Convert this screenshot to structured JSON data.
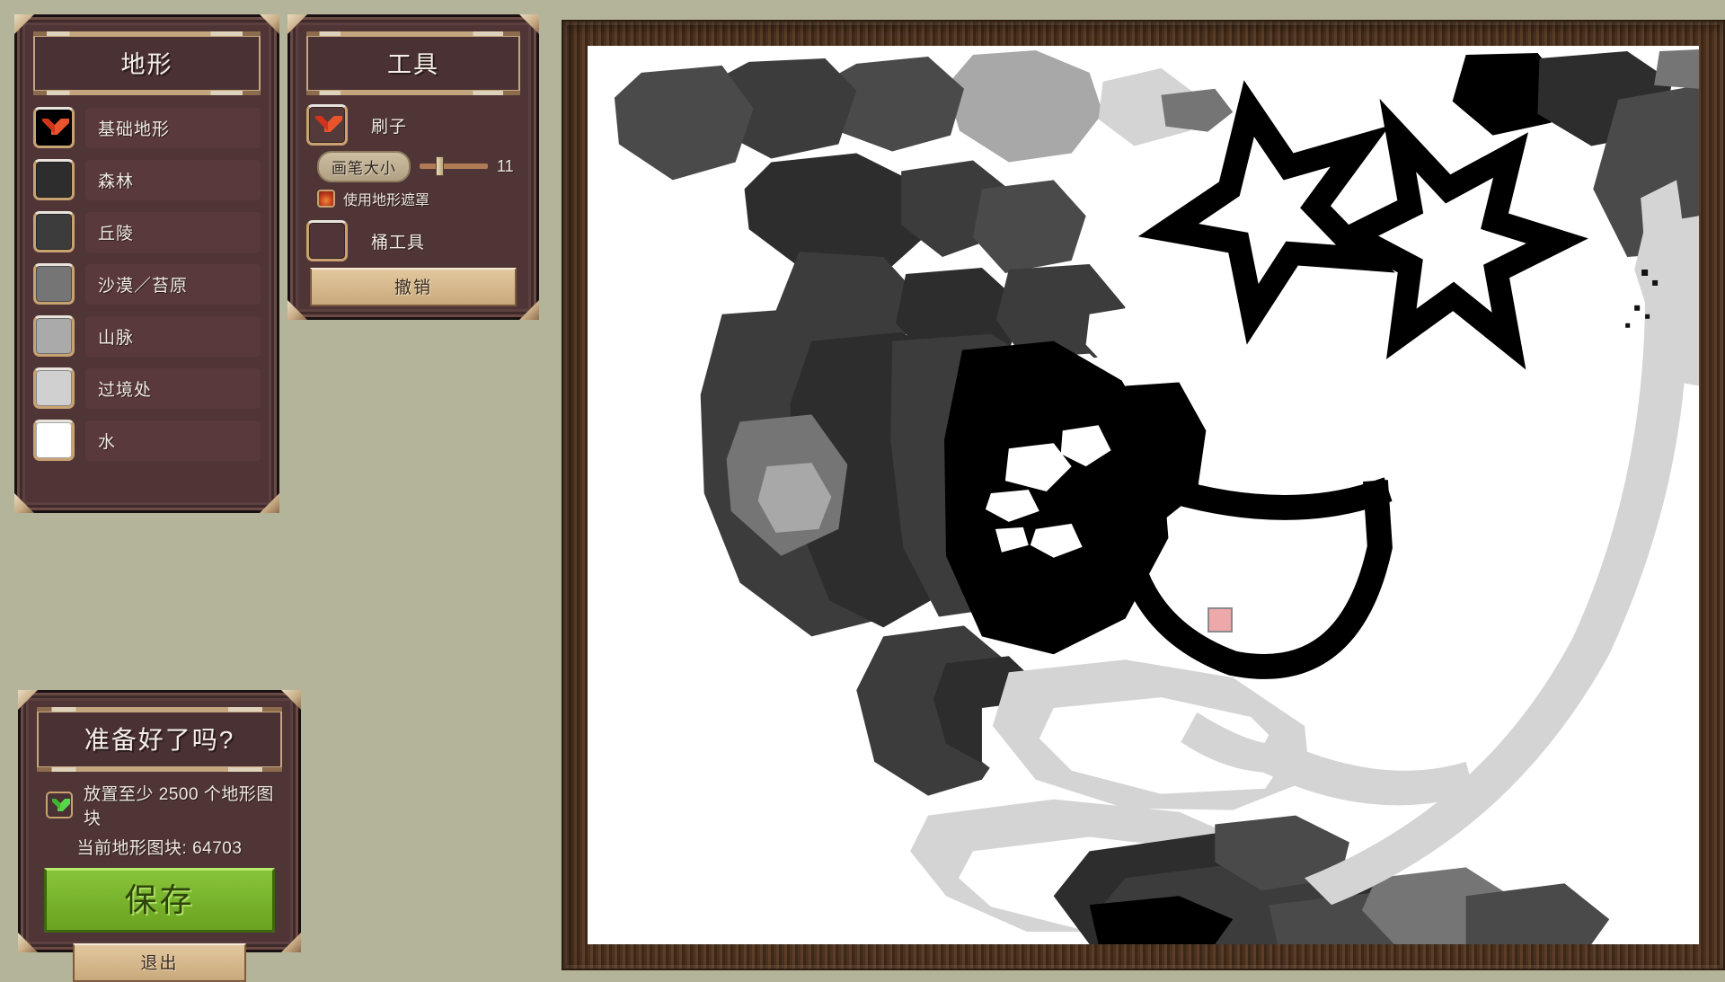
{
  "app": {
    "background_color": "#b4b49a",
    "panel_color": "#4f3536",
    "accent_gold": "#c9a271"
  },
  "terrain_panel": {
    "title": "地形",
    "items": [
      {
        "label": "基础地形",
        "swatch_color": "#000000",
        "selected": true
      },
      {
        "label": "森林",
        "swatch_color": "#2d2d2d",
        "selected": false
      },
      {
        "label": "丘陵",
        "swatch_color": "#3c3c3c",
        "selected": false
      },
      {
        "label": "沙漠／苔原",
        "swatch_color": "#757575",
        "selected": false
      },
      {
        "label": "山脉",
        "swatch_color": "#aaaaaa",
        "selected": false
      },
      {
        "label": "过境处",
        "swatch_color": "#d0d0d0",
        "selected": false
      },
      {
        "label": "水",
        "swatch_color": "#ffffff",
        "selected": false
      }
    ]
  },
  "tools_panel": {
    "title": "工具",
    "brush_tool": {
      "label": "刷子",
      "selected": true
    },
    "brush_size": {
      "label": "画笔大小",
      "value": "11",
      "slider_percent": 24
    },
    "terrain_mask": {
      "label": "使用地形遮罩",
      "enabled": true
    },
    "bucket_tool": {
      "label": "桶工具",
      "selected": false
    },
    "undo_button": "撤销"
  },
  "ready_dialog": {
    "title": "准备好了吗?",
    "requirement_prefix": "放置至少",
    "requirement_amount": "2500",
    "requirement_suffix": "个地形图块",
    "requirement_met": true,
    "current_label": "当前地形图块:",
    "current_value": "64703",
    "save_button": "保存",
    "exit_button": "退出"
  },
  "map": {
    "brush_cursor_color": "#eda9a9",
    "frame_color": "#4a3120",
    "water_color": "#ffffff",
    "palette": {
      "base": "#000000",
      "forest": "#2d2d2d",
      "hills": "#4a4a4a",
      "desert": "#757575",
      "mountain": "#a8a8a8",
      "crossing": "#d4d4d4"
    },
    "doodles": [
      "star-eye-left",
      "star-eye-right",
      "smile-mouth"
    ]
  }
}
